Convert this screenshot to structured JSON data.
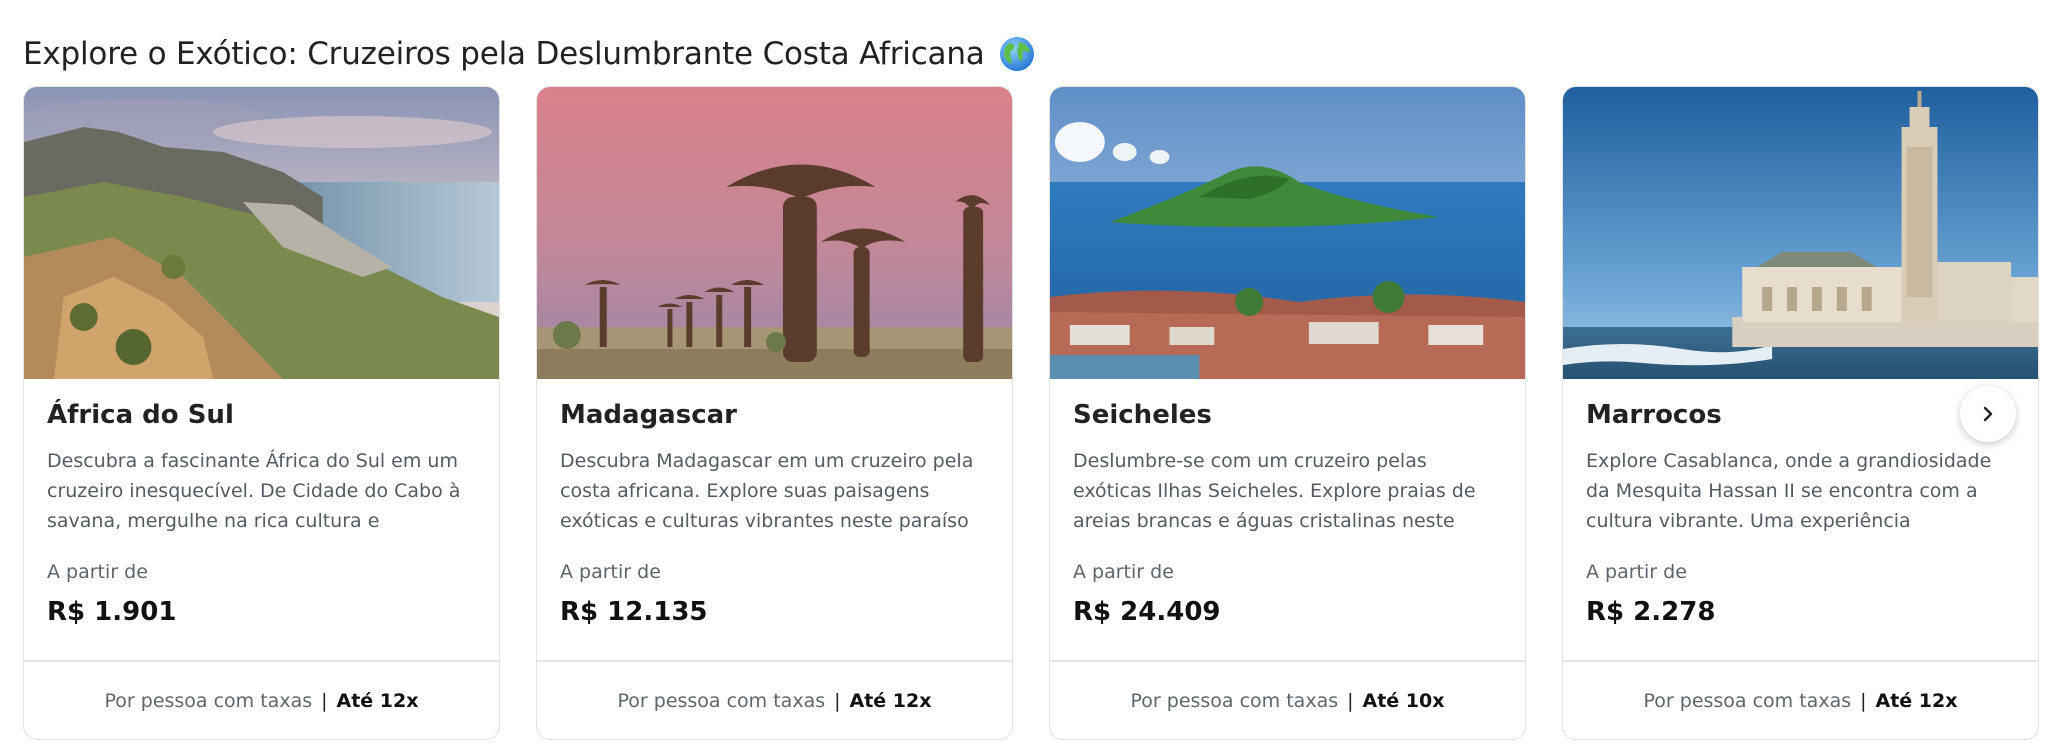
{
  "section": {
    "title": "Explore o Exótico: Cruzeiros pela Deslumbrante Costa Africana"
  },
  "colors": {
    "text_primary": "#222222",
    "text_secondary": "#555b63",
    "border": "#e3e3e3"
  },
  "cards": [
    {
      "title": "África do Sul",
      "description": "Descubra a fascinante África do Sul em um cruzeiro inesquecível. De Cidade do Cabo à savana, mergulhe na rica cultura e",
      "from_label": "A partir de",
      "price": "R$ 1.901",
      "footer_text": "Por pessoa com taxas",
      "separator": "|",
      "installments": "Até 12x"
    },
    {
      "title": "Madagascar",
      "description": "Descubra Madagascar em um cruzeiro pela costa africana. Explore suas paisagens exóticas e culturas vibrantes neste paraíso",
      "from_label": "A partir de",
      "price": "R$ 12.135",
      "footer_text": "Por pessoa com taxas",
      "separator": "|",
      "installments": "Até 12x"
    },
    {
      "title": "Seicheles",
      "description": "Deslumbre-se com um cruzeiro pelas exóticas Ilhas Seicheles. Explore praias de areias brancas e águas cristalinas neste",
      "from_label": "A partir de",
      "price": "R$ 24.409",
      "footer_text": "Por pessoa com taxas",
      "separator": "|",
      "installments": "Até 10x"
    },
    {
      "title": "Marrocos",
      "description": "Explore Casablanca, onde a grandiosidade da Mesquita Hassan II se encontra com a cultura vibrante. Uma experiência",
      "from_label": "A partir de",
      "price": "R$ 2.278",
      "footer_text": "Por pessoa com taxas",
      "separator": "|",
      "installments": "Até 12x"
    }
  ],
  "icons": {
    "title_emoji": "globe-icon",
    "carousel_next": "chevron-right-icon"
  }
}
